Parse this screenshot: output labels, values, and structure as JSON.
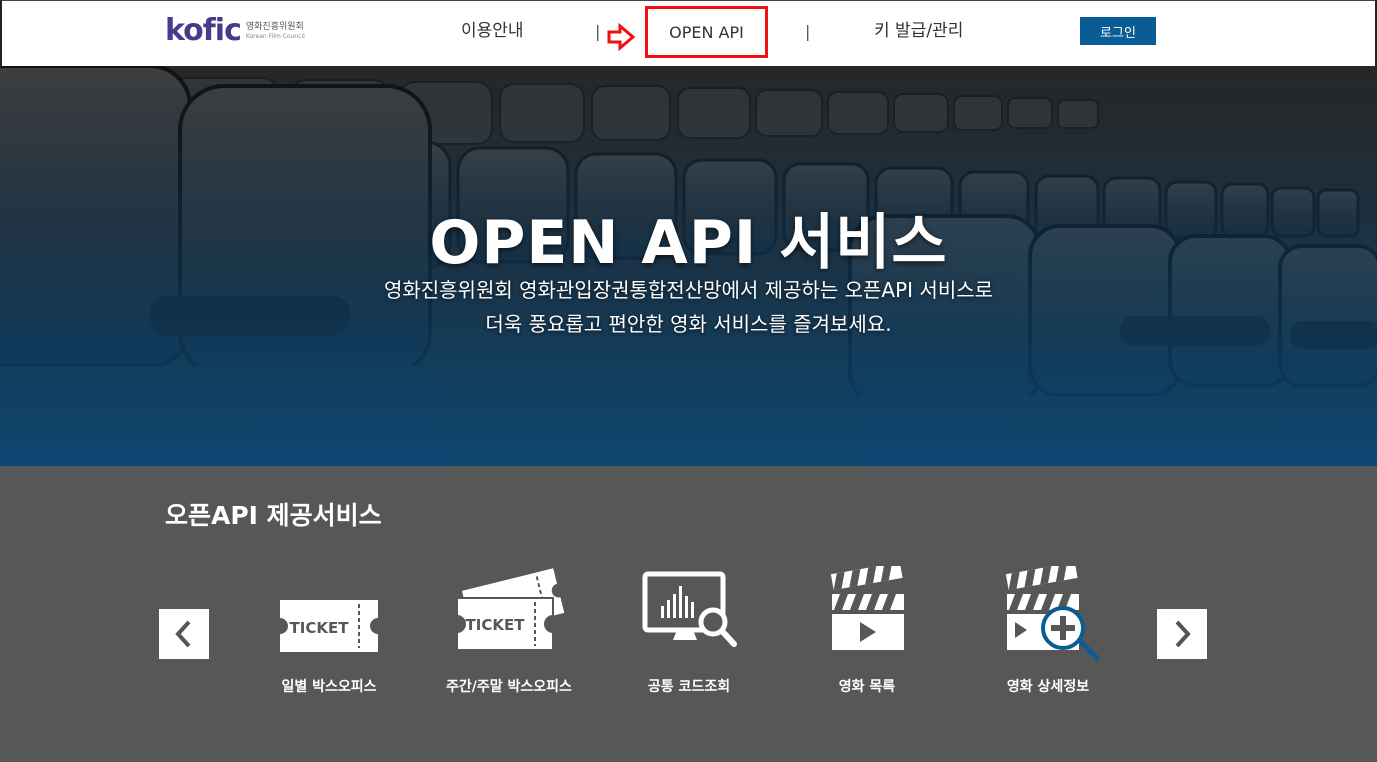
{
  "header": {
    "logo": {
      "word": "kofic",
      "kr": "영화진흥위원회",
      "en": "Korean Film Council"
    },
    "nav": [
      {
        "label": "이용안내"
      },
      {
        "label": "OPEN API"
      },
      {
        "label": "키 발급/관리"
      }
    ],
    "separator": "|",
    "login_label": "로그인",
    "highlight_color": "#ee1111",
    "login_color": "#0a5c94"
  },
  "hero": {
    "title": "OPEN API 서비스",
    "subtitle_line1": "영화진흥위원회 영화관입장권통합전산망에서 제공하는 오픈API 서비스로",
    "subtitle_line2": "더욱 풍요롭고 편안한 영화 서비스를 즐겨보세요."
  },
  "services": {
    "title": "오픈API 제공서비스",
    "prev_icon": "chevron-left-icon",
    "next_icon": "chevron-right-icon",
    "items": [
      {
        "label": "일별 박스오피스",
        "icon": "ticket-icon"
      },
      {
        "label": "주간/주말 박스오피스",
        "icon": "tickets-icon"
      },
      {
        "label": "공통 코드조회",
        "icon": "monitor-search-icon"
      },
      {
        "label": "영화 목록",
        "icon": "clapperboard-icon"
      },
      {
        "label": "영화 상세정보",
        "icon": "clapperboard-zoom-icon"
      }
    ],
    "ticket_text": "TICKET"
  }
}
